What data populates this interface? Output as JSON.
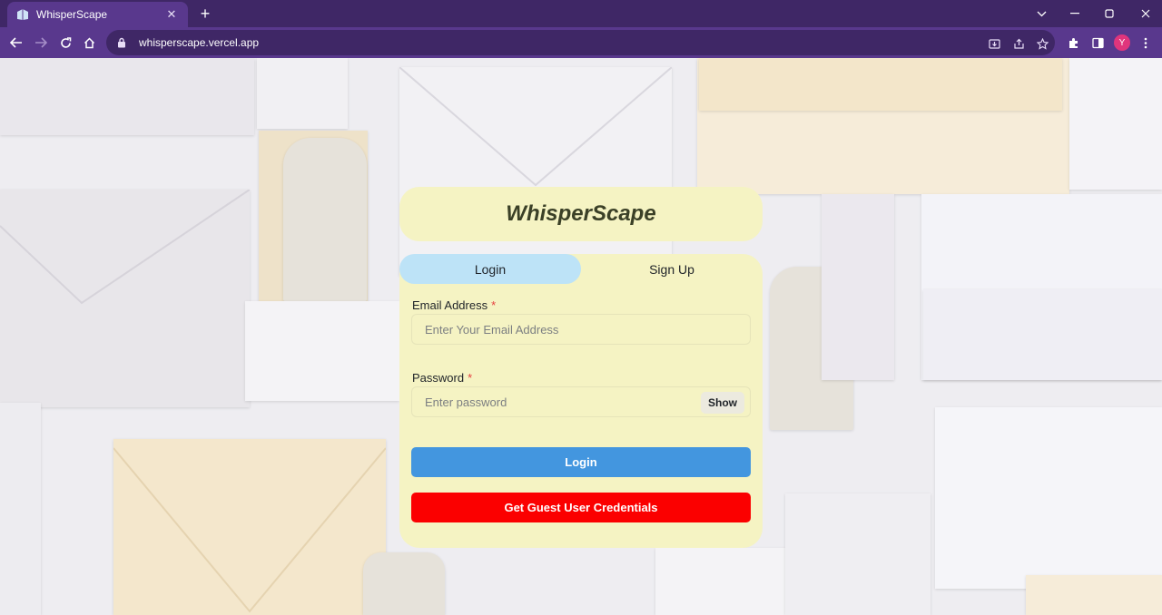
{
  "browser": {
    "tab_title": "WhisperScape",
    "tab_close": "✕",
    "new_tab": "+",
    "url": "whisperscape.vercel.app",
    "avatar_letter": "Y",
    "accent": "#59388d"
  },
  "app": {
    "title": "WhisperScape"
  },
  "tabs": {
    "login": "Login",
    "signup": "Sign Up"
  },
  "form": {
    "email_label": "Email Address",
    "email_placeholder": "Enter Your Email Address",
    "password_label": "Password",
    "password_placeholder": "Enter password",
    "required_mark": "*",
    "show_label": "Show",
    "login_button": "Login",
    "guest_button": "Get Guest User Credentials"
  },
  "colors": {
    "card": "#f5f3c3",
    "active_tab": "#bde3f7",
    "login_button": "#4396df",
    "guest_button": "#fb0000"
  }
}
